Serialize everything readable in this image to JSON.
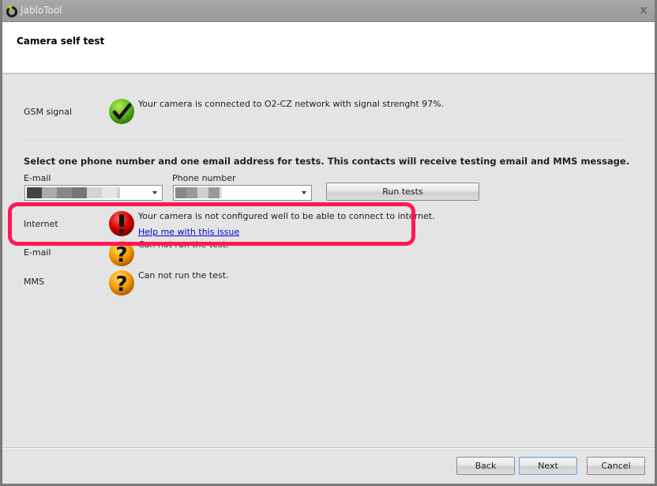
{
  "window": {
    "title": "JabloTool",
    "close_glyph": "x"
  },
  "header": {
    "title": "Camera self test"
  },
  "gsm": {
    "label": "GSM signal",
    "icon": "check-icon",
    "status": "Your camera is connected to O2-CZ network with signal strenght 97%."
  },
  "contacts": {
    "instruction": "Select one phone number and one email address for tests. This contacts will receive testing email and MMS message.",
    "email_label": "E-mail",
    "phone_label": "Phone number",
    "email_value": "(redacted)",
    "phone_value": "(redacted)",
    "run_label": "Run tests"
  },
  "tests": [
    {
      "label": "Internet",
      "icon": "error-icon",
      "status": "Your camera is not configured well to be able to connect to internet.",
      "link": "Help me with this issue"
    },
    {
      "label": "E-mail",
      "icon": "question-icon",
      "status": "Can not run the test."
    },
    {
      "label": "MMS",
      "icon": "question-icon",
      "status": "Can not run the test."
    }
  ],
  "footer": {
    "back_label": "Back",
    "next_label": "Next",
    "cancel_label": "Cancel"
  },
  "colors": {
    "highlight": "#ff1757",
    "link": "#0000d0",
    "success": "#5fb320",
    "error": "#d40000",
    "warning": "#f59a00"
  }
}
